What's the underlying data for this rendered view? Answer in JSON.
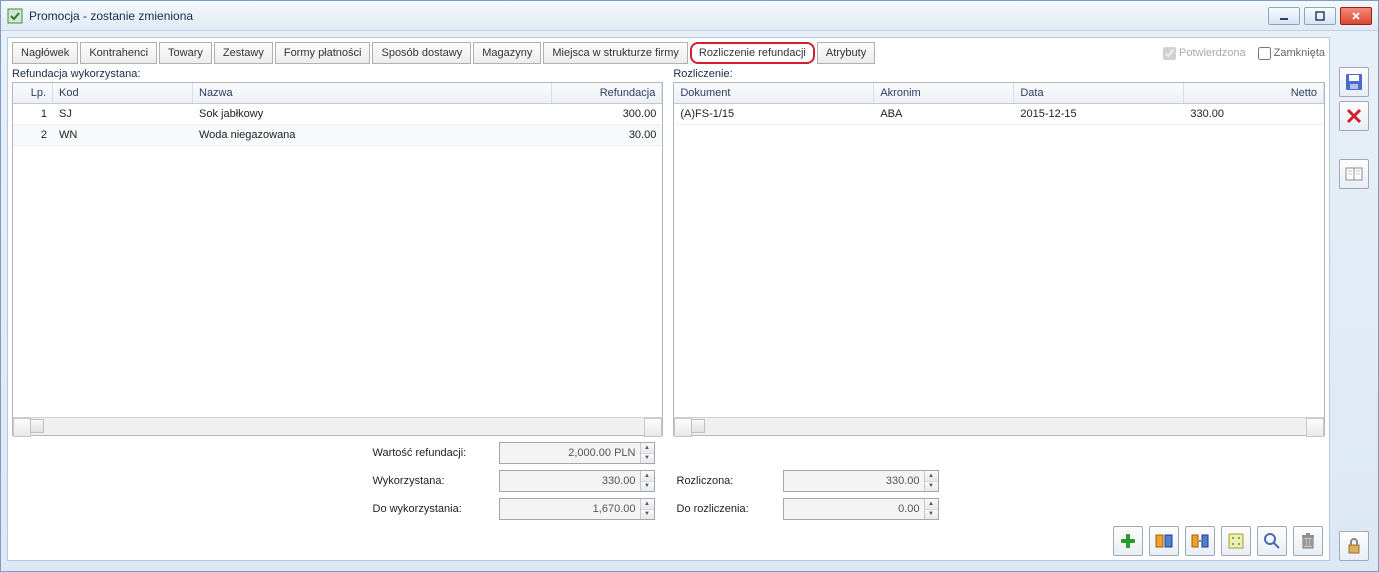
{
  "window": {
    "title": "Promocja - zostanie zmieniona"
  },
  "tabs": [
    {
      "label": "Nagłówek"
    },
    {
      "label": "Kontrahenci"
    },
    {
      "label": "Towary"
    },
    {
      "label": "Zestawy"
    },
    {
      "label": "Formy płatności"
    },
    {
      "label": "Sposób dostawy"
    },
    {
      "label": "Magazyny"
    },
    {
      "label": "Miejsca w strukturze firmy"
    },
    {
      "label": "Rozliczenie refundacji",
      "highlighted": true
    },
    {
      "label": "Atrybuty"
    }
  ],
  "checks": {
    "confirmed_label": "Potwierdzona",
    "confirmed_checked": true,
    "closed_label": "Zamknięta",
    "closed_checked": false
  },
  "leftPane": {
    "title": "Refundacja wykorzystana:",
    "headers": {
      "lp": "Lp.",
      "kod": "Kod",
      "nazwa": "Nazwa",
      "refundacja": "Refundacja"
    },
    "rows": [
      {
        "lp": "1",
        "kod": "SJ",
        "nazwa": "Sok jabłkowy",
        "ref": "300.00"
      },
      {
        "lp": "2",
        "kod": "WN",
        "nazwa": "Woda niegazowana",
        "ref": "30.00"
      }
    ]
  },
  "rightPane": {
    "title": "Rozliczenie:",
    "headers": {
      "dok": "Dokument",
      "akr": "Akronim",
      "data": "Data",
      "netto": "Netto"
    },
    "rows": [
      {
        "dok": "(A)FS-1/15",
        "akr": "ABA",
        "data": "2015-12-15",
        "netto": "330.00"
      }
    ]
  },
  "summaryLeft": {
    "wartosc_label": "Wartość refundacji:",
    "wartosc_value": "2,000.00 PLN",
    "wykorzystana_label": "Wykorzystana:",
    "wykorzystana_value": "330.00",
    "do_wyk_label": "Do wykorzystania:",
    "do_wyk_value": "1,670.00"
  },
  "summaryRight": {
    "rozliczona_label": "Rozliczona:",
    "rozliczona_value": "330.00",
    "do_rozl_label": "Do rozliczenia:",
    "do_rozl_value": "0.00"
  }
}
